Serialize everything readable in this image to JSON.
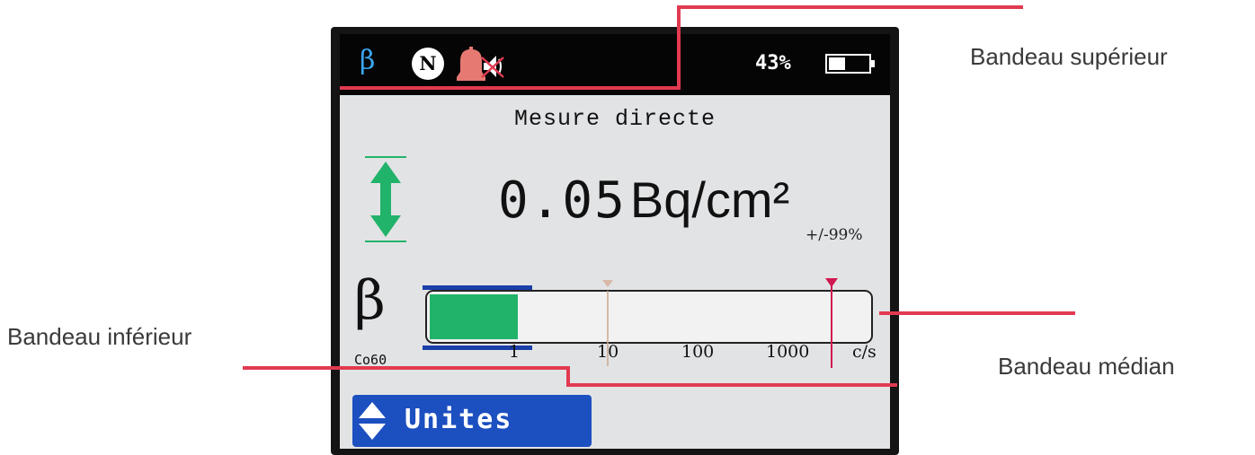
{
  "topbar": {
    "radiation_type": "β",
    "mode_badge": "N",
    "alarm_icon": "bell-muted-icon",
    "battery_percent": "43%",
    "battery_level": 0.43
  },
  "screen": {
    "title": "Mesure directe",
    "measurement": {
      "value": "0.05",
      "unit": "Bq/cm²",
      "uncertainty": "+/-99%"
    },
    "particle": "β",
    "isotope": "Co60",
    "gauge": {
      "ticks": [
        "1",
        "10",
        "100",
        "1000"
      ],
      "unit": "c/s",
      "fill_fraction": 0.2,
      "threshold_low": 10,
      "threshold_high": 3000
    },
    "bottom_button": "Unites"
  },
  "callouts": {
    "top": "Bandeau supérieur",
    "bottom": "Bandeau inférieur",
    "middle": "Bandeau médian"
  },
  "colors": {
    "accent_red": "#e23a51",
    "gauge_fill": "#22b36a",
    "button_blue": "#1c4fc0",
    "beta_blue": "#3aa7f0"
  }
}
